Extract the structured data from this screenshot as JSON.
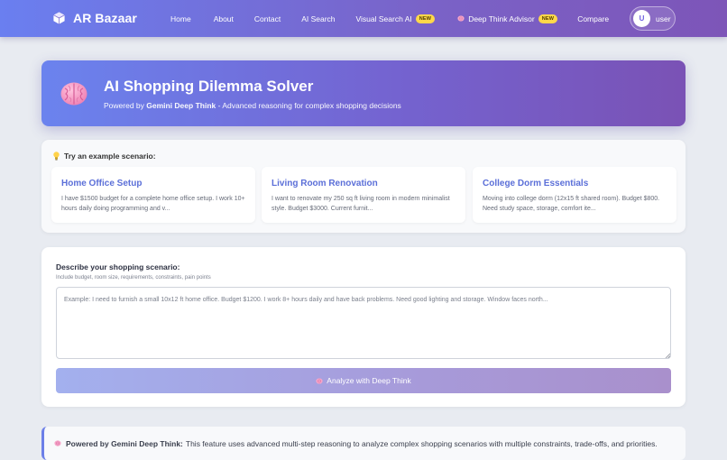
{
  "nav": {
    "brand": "AR Bazaar",
    "links": [
      {
        "label": "Home"
      },
      {
        "label": "About"
      },
      {
        "label": "Contact"
      },
      {
        "label": "AI Search"
      },
      {
        "label": "Visual Search AI",
        "badge": "NEW"
      },
      {
        "label": "Deep Think Advisor",
        "badge": "NEW"
      },
      {
        "label": "Compare"
      }
    ],
    "user": {
      "initial": "U",
      "name": "user"
    }
  },
  "hero": {
    "title": "AI Shopping Dilemma Solver",
    "subtitle_prefix": "Powered by ",
    "subtitle_strong": "Gemini Deep Think",
    "subtitle_suffix": " - Advanced reasoning for complex shopping decisions",
    "icon": "brain-icon"
  },
  "examples": {
    "heading": "Try an example scenario:",
    "cards": [
      {
        "title": "Home Office Setup",
        "text": "I have $1500 budget for a complete home office setup. I work 10+ hours daily doing programming and v..."
      },
      {
        "title": "Living Room Renovation",
        "text": "I want to renovate my 250 sq ft living room in modern minimalist style. Budget $3000. Current furnit..."
      },
      {
        "title": "College Dorm Essentials",
        "text": "Moving into college dorm (12x15 ft shared room). Budget $800. Need study space, storage, comfort ite..."
      }
    ]
  },
  "form": {
    "label": "Describe your shopping scenario:",
    "hint": "Include budget, room size, requirements, constraints, pain points",
    "placeholder": "Example: I need to furnish a small 10x12 ft home office. Budget $1200. I work 8+ hours daily and have back problems. Need good lighting and storage. Window faces north...",
    "value": "",
    "button_label": "Analyze with Deep Think"
  },
  "info": {
    "strong": "Powered by Gemini Deep Think:",
    "text": "This feature uses advanced multi-step reasoning to analyze complex shopping scenarios with multiple constraints, trade-offs, and priorities."
  },
  "colors": {
    "accent": "#6b7fe8",
    "accent_purple": "#7a52b5",
    "badge": "#ffd84a",
    "card_title": "#5b6fd8"
  }
}
